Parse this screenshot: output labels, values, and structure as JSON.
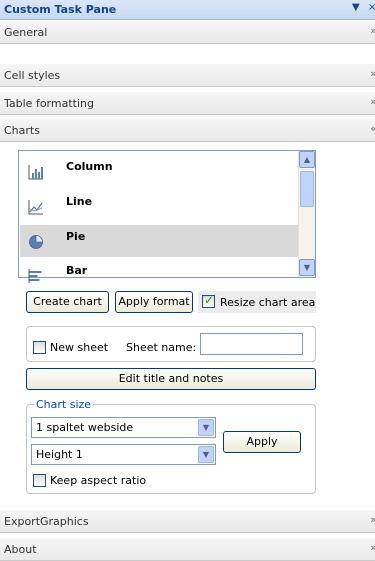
{
  "pane": {
    "title": "Custom Task Pane",
    "dropdown_glyph": "▼",
    "close_glyph": "×"
  },
  "sections": {
    "general": "General",
    "cell_styles": "Cell styles",
    "table_formatting": "Table formatting",
    "charts": "Charts",
    "export_graphics": "ExportGraphics",
    "about": "About"
  },
  "chevrons": {
    "collapsed": "»",
    "expanded": "«"
  },
  "chart_list": {
    "items": [
      {
        "label": "Column",
        "icon": "column-chart-icon"
      },
      {
        "label": "Line",
        "icon": "line-chart-icon"
      },
      {
        "label": "Pie",
        "icon": "pie-chart-icon"
      },
      {
        "label": "Bar",
        "icon": "bar-chart-icon"
      }
    ],
    "selected": "Pie"
  },
  "actions": {
    "create_chart": "Create chart",
    "apply_format": "Apply format",
    "resize_chart_area": "Resize chart area",
    "resize_checked": true
  },
  "sheet": {
    "new_sheet": "New sheet",
    "new_sheet_checked": false,
    "sheet_name_label": "Sheet name:",
    "sheet_name_value": ""
  },
  "edit_title_notes": "Edit title and notes",
  "chart_size": {
    "legend": "Chart size",
    "width_selected": "1 spaltet webside",
    "height_selected": "Height 1",
    "apply": "Apply",
    "keep_aspect_ratio": "Keep aspect ratio",
    "keep_aspect_checked": false
  },
  "colors": {
    "title_text": "#15428b",
    "selection_bg": "#d9d9d9",
    "accent_border": "#003c74"
  }
}
